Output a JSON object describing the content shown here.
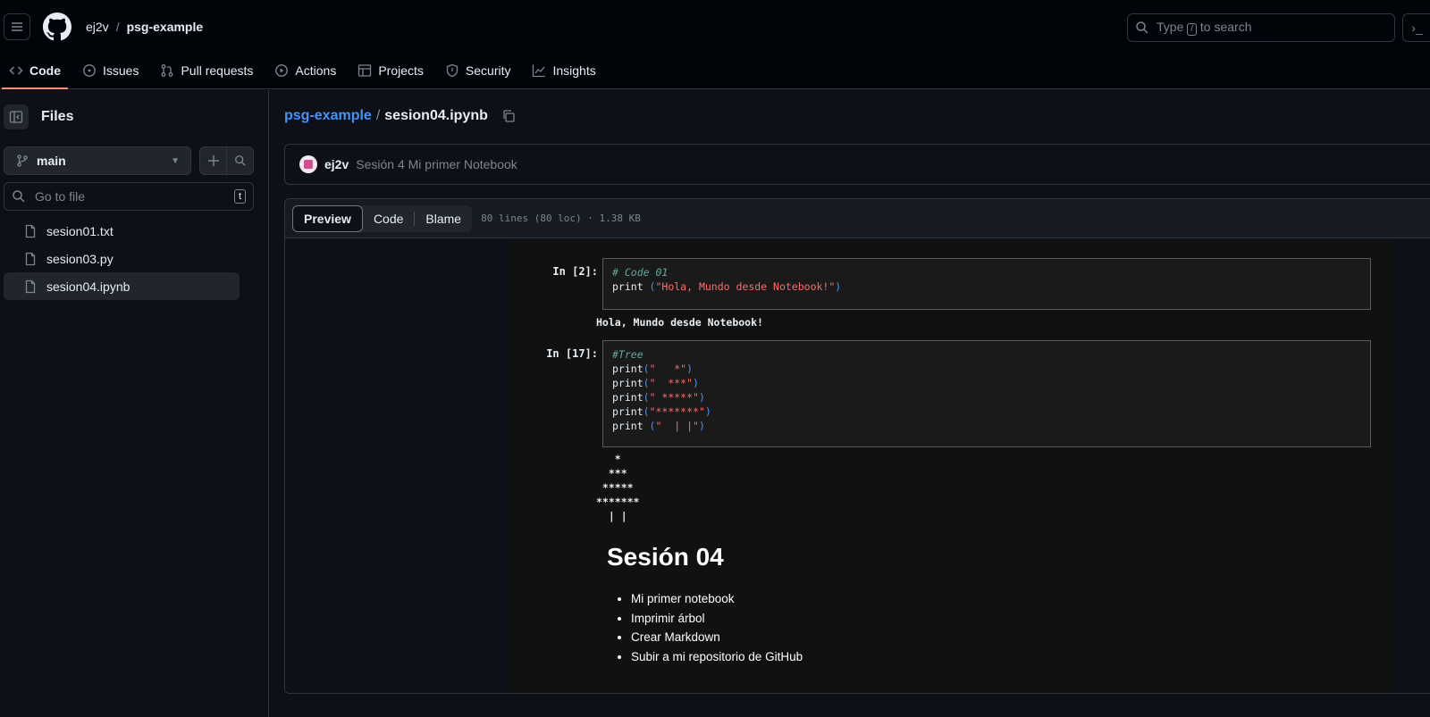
{
  "header": {
    "owner": "ej2v",
    "separator": "/",
    "repo": "psg-example",
    "search_placeholder_prefix": "Type",
    "search_key": "/",
    "search_placeholder_suffix": "to search",
    "terminal_glyph": "›_"
  },
  "nav": {
    "code": "Code",
    "issues": "Issues",
    "pulls": "Pull requests",
    "actions": "Actions",
    "projects": "Projects",
    "security": "Security",
    "insights": "Insights"
  },
  "sidebar": {
    "title": "Files",
    "branch": "main",
    "goto_placeholder": "Go to file",
    "goto_key": "t",
    "files": [
      {
        "name": "sesion01.txt"
      },
      {
        "name": "sesion03.py"
      },
      {
        "name": "sesion04.ipynb"
      }
    ]
  },
  "file": {
    "repo": "psg-example",
    "separator": "/",
    "name": "sesion04.ipynb"
  },
  "commit": {
    "author": "ej2v",
    "message": "Sesión 4 Mi primer Notebook"
  },
  "viewer": {
    "tab_preview": "Preview",
    "tab_code": "Code",
    "tab_blame": "Blame",
    "meta": "80 lines (80 loc) · 1.38 KB"
  },
  "notebook": {
    "cell1": {
      "prompt": "In [2]:",
      "comment": "# Code 01",
      "fn": "print",
      "lp": " (",
      "str": "\"Hola, Mundo desde Notebook!\"",
      "rp": ")",
      "output": "Hola, Mundo desde Notebook!"
    },
    "cell2": {
      "prompt": "In [17]:",
      "comment": "#Tree",
      "l1_fn": "print",
      "l1_lp": "(",
      "l1_str": "\"   *\"",
      "l1_rp": ")",
      "l2_fn": "print",
      "l2_lp": "(",
      "l2_str": "\"  ***\"",
      "l2_rp": ")",
      "l3_fn": "print",
      "l3_lp": "(",
      "l3_str": "\" *****\"",
      "l3_rp": ")",
      "l4_fn": "print",
      "l4_lp": "(",
      "l4_str": "\"*******\"",
      "l4_rp": ")",
      "l5_fn": "print",
      "l5_lp": " (",
      "l5_str": "\"  | |\"",
      "l5_rp": ")",
      "output": "   *\n  ***\n *****\n*******\n  | |"
    },
    "markdown": {
      "heading": "Sesión 04",
      "items": [
        "Mi primer notebook",
        "Imprimir árbol",
        "Crear Markdown",
        "Subir a mi repositorio de GitHub"
      ]
    }
  },
  "colors": {
    "accent_underline": "#fd8c73",
    "link": "#4493f8",
    "string": "#ff6b6b",
    "comment": "#5fa8a0"
  }
}
